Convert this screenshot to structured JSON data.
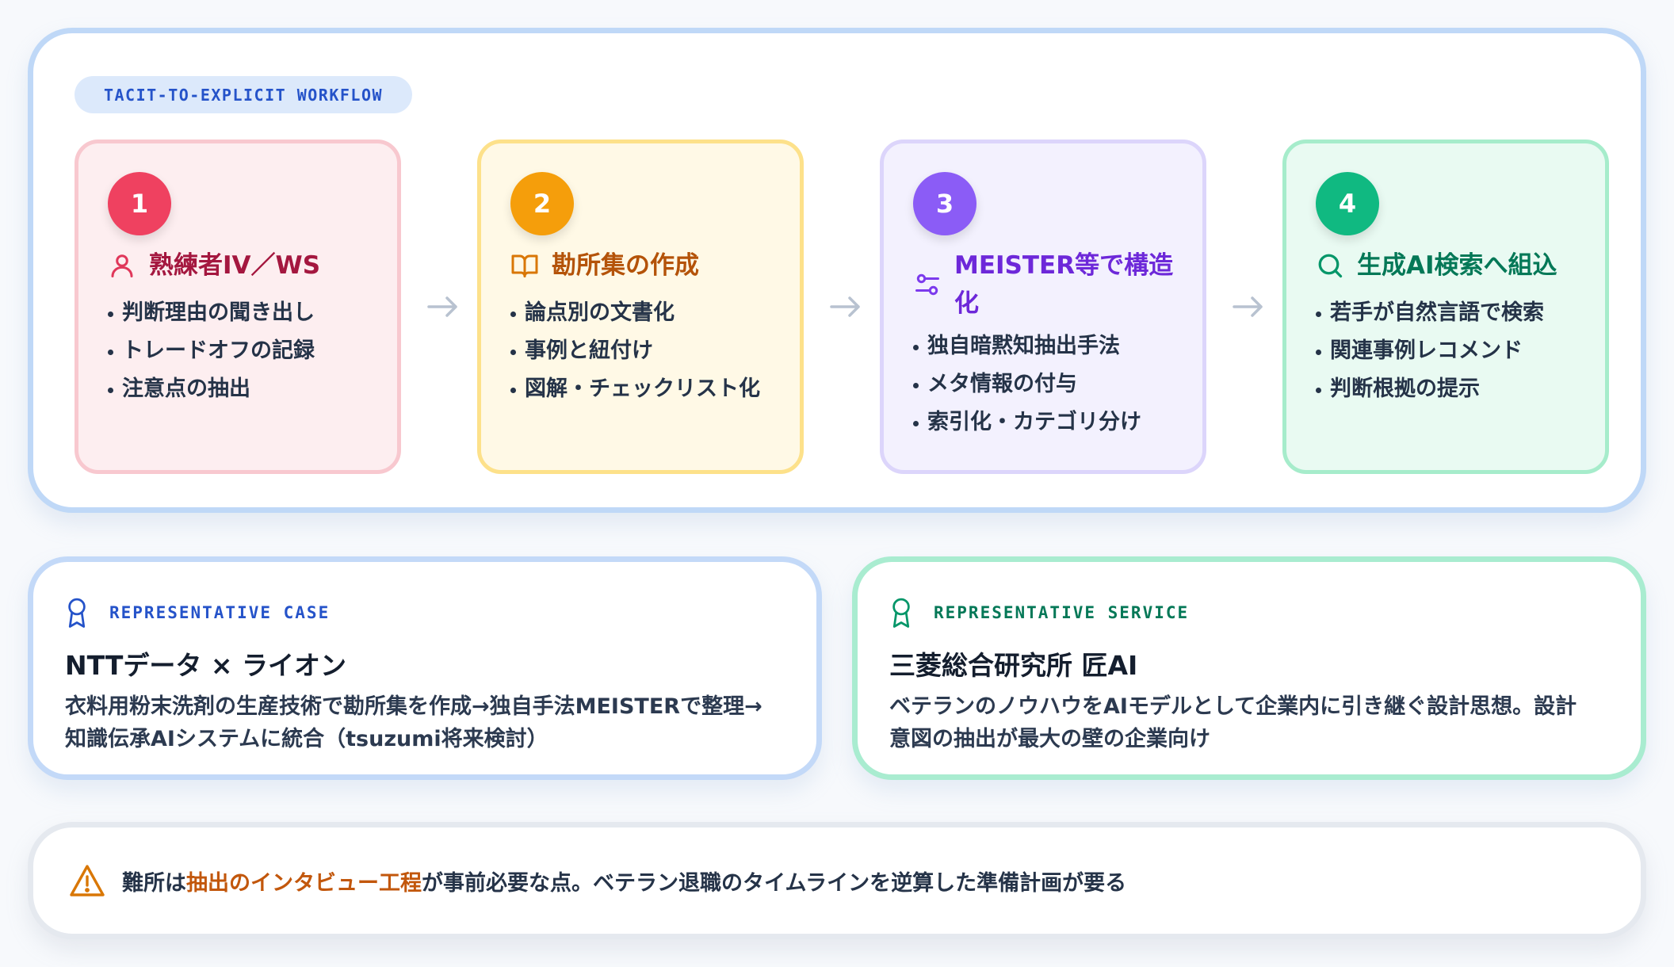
{
  "workflow": {
    "pill_label": "TACIT-TO-EXPLICIT WORKFLOW",
    "steps": [
      {
        "number": "1",
        "icon": "person-icon",
        "title": "熟練者IV／WS",
        "bullets": [
          "判断理由の聞き出し",
          "トレードオフの記録",
          "注意点の抽出"
        ]
      },
      {
        "number": "2",
        "icon": "book-icon",
        "title": "勘所集の作成",
        "bullets": [
          "論点別の文書化",
          "事例と紐付け",
          "図解・チェックリスト化"
        ]
      },
      {
        "number": "3",
        "icon": "sliders-icon",
        "title": "MEISTER等で構造化",
        "bullets": [
          "独自暗黙知抽出手法",
          "メタ情報の付与",
          "索引化・カテゴリ分け"
        ]
      },
      {
        "number": "4",
        "icon": "search-icon",
        "title": "生成AI検索へ組込",
        "bullets": [
          "若手が自然言語で検索",
          "関連事例レコメンド",
          "判断根拠の提示"
        ]
      }
    ]
  },
  "cases": [
    {
      "label": "REPRESENTATIVE CASE",
      "icon": "award-icon",
      "title": "NTTデータ × ライオン",
      "desc_line1": "衣料用粉末洗剤の生産技術で勘所集を作成→独自手法MEISTERで整理→",
      "desc_line2": "知識伝承AIシステムに統合（tsuzumi将来検討）"
    },
    {
      "label": "REPRESENTATIVE SERVICE",
      "icon": "award-icon",
      "title": "三菱総合研究所 匠AI",
      "desc_line1": "ベテランのノウハウをAIモデルとして企業内に引き継ぐ設計思想。設計",
      "desc_line2": "意図の抽出が最大の壁の企業向け"
    }
  ],
  "warning": {
    "icon": "warning-icon",
    "text_before": "難所は",
    "text_emphasis": "抽出のインタビュー工程",
    "text_after": "が事前必要な点。ベテラン退職のタイムラインを逆算した準備計画が要る"
  },
  "colors": {
    "step1": "#ef4160",
    "step2": "#f59e0b",
    "step3": "#8b5cf6",
    "step4": "#10b981",
    "case_accent": "#2553c9",
    "service_accent": "#047857",
    "warning_accent": "#c2570c"
  }
}
